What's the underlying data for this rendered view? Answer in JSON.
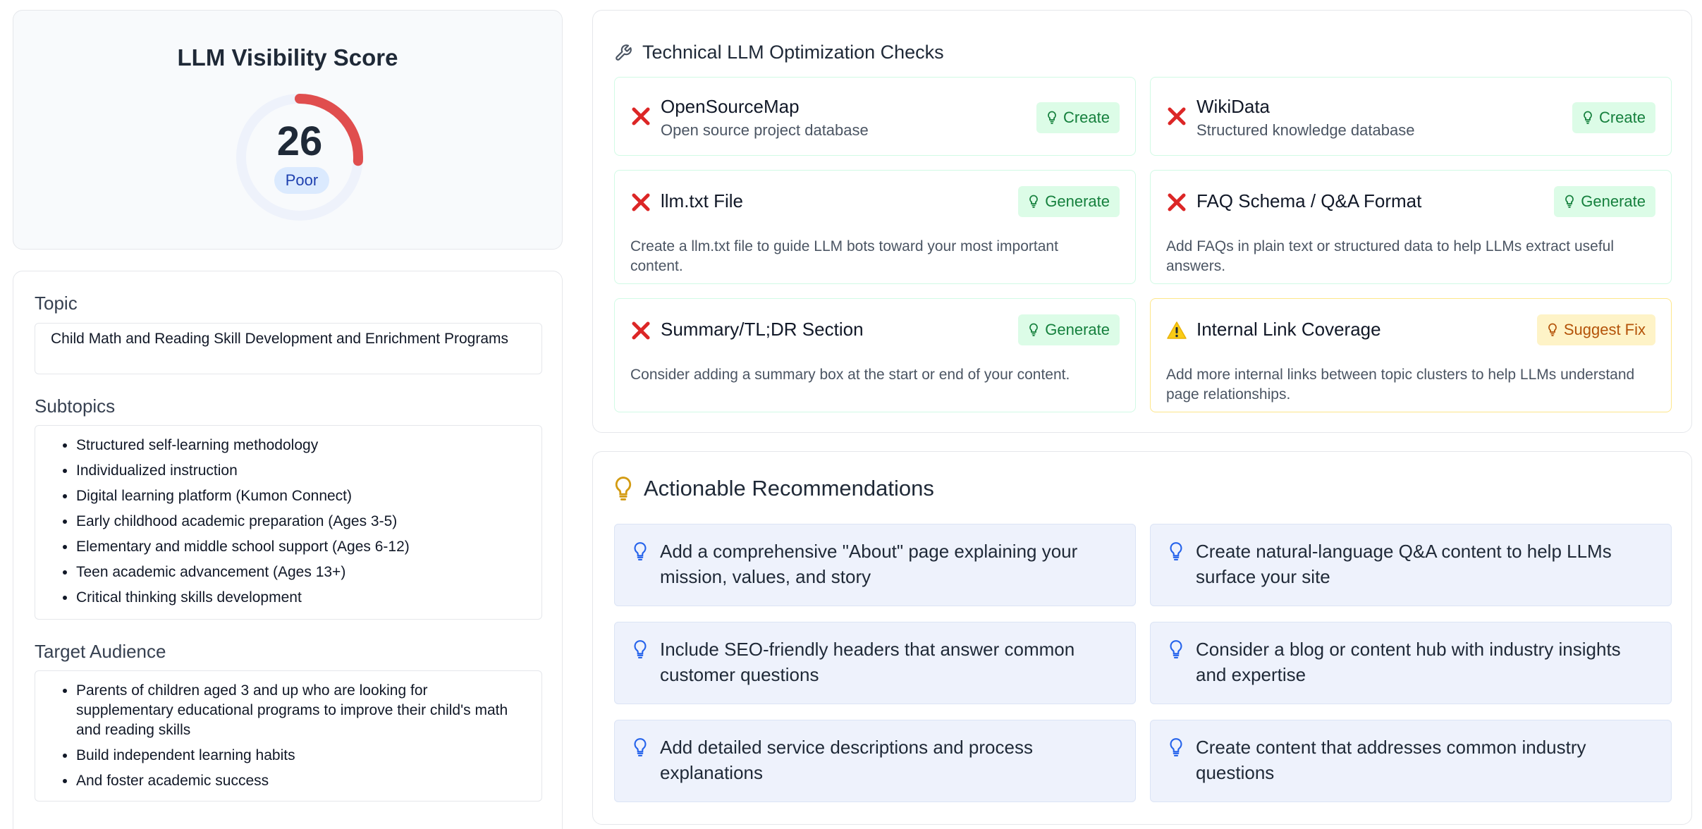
{
  "score": {
    "title": "LLM Visibility Score",
    "value": "26",
    "label": "Poor",
    "fraction": 0.26,
    "colors": {
      "arc": "#e04e4e",
      "track": "#eef2fb",
      "badge_bg": "#dbeafe"
    }
  },
  "topic": {
    "label": "Topic",
    "value": "Child Math and Reading Skill Development and Enrichment Programs"
  },
  "subtopics": {
    "label": "Subtopics",
    "items": [
      "Structured self-learning methodology",
      "Individualized instruction",
      "Digital learning platform (Kumon Connect)",
      "Early childhood academic preparation (Ages 3-5)",
      "Elementary and middle school support (Ages 6-12)",
      "Teen academic advancement (Ages 13+)",
      "Critical thinking skills development"
    ]
  },
  "audience": {
    "label": "Target Audience",
    "items": [
      "Parents of children aged 3 and up who are looking for supplementary educational programs to improve their child's math and reading skills",
      "Build independent learning habits",
      "And foster academic success"
    ]
  },
  "checks": {
    "title": "Technical LLM Optimization Checks",
    "items": [
      {
        "name": "OpenSourceMap",
        "sub": "Open source project database",
        "status": "fail",
        "action": "Create",
        "icon": "x-icon"
      },
      {
        "name": "WikiData",
        "sub": "Structured knowledge database",
        "status": "fail",
        "action": "Create",
        "icon": "x-icon"
      },
      {
        "name": "llm.txt File",
        "desc": "Create a llm.txt file to guide LLM bots toward your most important content.",
        "status": "fail",
        "action": "Generate",
        "icon": "x-icon"
      },
      {
        "name": "FAQ Schema / Q&A Format",
        "desc": "Add FAQs in plain text or structured data to help LLMs extract useful answers.",
        "status": "fail",
        "action": "Generate",
        "icon": "x-icon"
      },
      {
        "name": "Summary/TL;DR Section",
        "desc": "Consider adding a summary box at the start or end of your content.",
        "status": "fail",
        "action": "Generate",
        "icon": "x-icon"
      },
      {
        "name": "Internal Link Coverage",
        "desc": "Add more internal links between topic clusters to help LLMs understand page relationships.",
        "status": "warn",
        "action": "Suggest Fix",
        "icon": "warning-icon"
      }
    ]
  },
  "recommendations": {
    "title": "Actionable Recommendations",
    "items": [
      "Add a comprehensive \"About\" page explaining your mission, values, and story",
      "Create natural-language Q&A content to help LLMs surface your site",
      "Include SEO-friendly headers that answer common customer questions",
      "Consider a blog or content hub with industry insights and expertise",
      "Add detailed service descriptions and process explanations",
      "Create content that addresses common industry questions"
    ]
  }
}
